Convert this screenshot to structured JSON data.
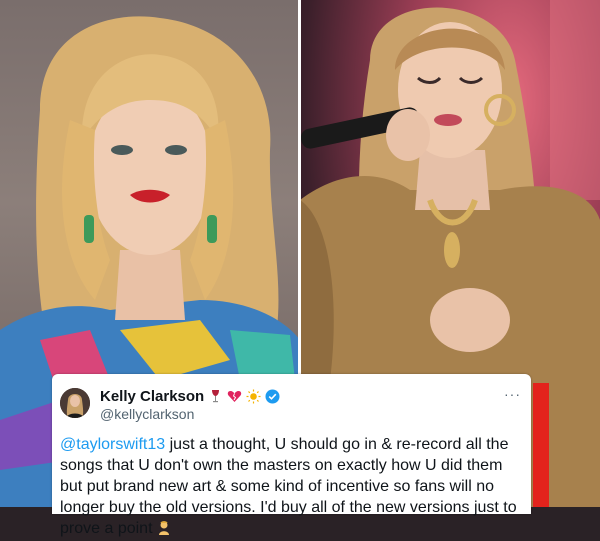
{
  "tweet": {
    "display_name": "Kelly Clarkson",
    "name_emojis": [
      "wine-glass-icon",
      "broken-heart-icon",
      "sun-icon"
    ],
    "verified": true,
    "handle": "@kellyclarkson",
    "more_label": "···",
    "mention": "@taylorswift13",
    "body_text": " just a thought, U should go in & re-record all the songs that U don't own the masters on exactly how U did them but put brand new art & some kind of incentive so fans will no longer buy the old versions. I'd buy all of the new versions just to prove a point",
    "trailing_emoji": "person-tipping-hand-icon"
  },
  "colors": {
    "mention": "#1d9bf0",
    "verified_badge": "#1d9bf0",
    "accent_strip": "#e3231c"
  }
}
